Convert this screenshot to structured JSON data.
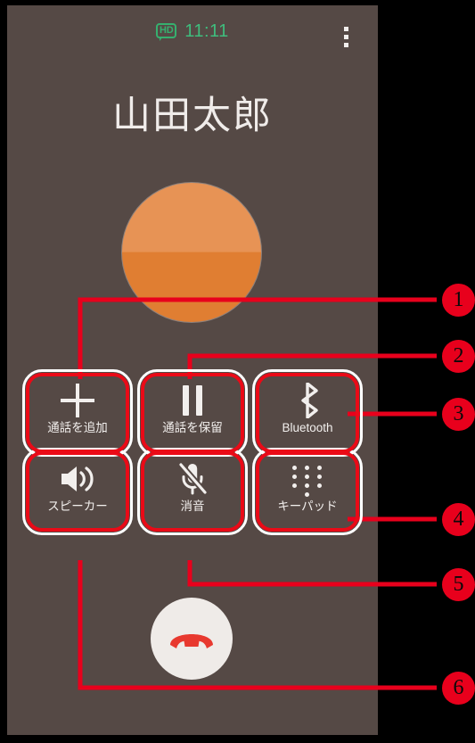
{
  "screen": {
    "background_color": "#554945",
    "outer_background_color": "#000000"
  },
  "status_bar": {
    "hd_badge_label": "HD",
    "hd_icon_name": "hd-voice-icon",
    "time": "11:11",
    "time_color": "#3fbd7d",
    "overflow_menu_name": "more-options-icon"
  },
  "caller": {
    "name": "山田太郎",
    "avatar_name": "caller-avatar",
    "avatar_color_top": "#e79355",
    "avatar_color_bottom": "#e07e32"
  },
  "buttons": [
    {
      "id": "add-call",
      "label": "通話を追加",
      "icon": "plus-icon",
      "highlighted": true
    },
    {
      "id": "hold-call",
      "label": "通話を保留",
      "icon": "pause-icon",
      "highlighted": true
    },
    {
      "id": "bluetooth",
      "label": "Bluetooth",
      "icon": "bluetooth-icon",
      "highlighted": true
    },
    {
      "id": "speaker",
      "label": "スピーカー",
      "icon": "speaker-icon",
      "highlighted": true
    },
    {
      "id": "mute",
      "label": "消音",
      "icon": "microphone-off-icon",
      "highlighted": true
    },
    {
      "id": "keypad",
      "label": "キーパッド",
      "icon": "dialpad-icon",
      "highlighted": true
    }
  ],
  "end_call": {
    "icon": "end-call-handset-icon",
    "icon_color": "#e8392f",
    "background_color": "#efebe8"
  },
  "callouts": {
    "color": "#e8001c",
    "items": [
      {
        "number": "1",
        "target": "add-call"
      },
      {
        "number": "2",
        "target": "hold-call"
      },
      {
        "number": "3",
        "target": "bluetooth"
      },
      {
        "number": "4",
        "target": "keypad"
      },
      {
        "number": "5",
        "target": "mute"
      },
      {
        "number": "6",
        "target": "speaker"
      }
    ]
  }
}
